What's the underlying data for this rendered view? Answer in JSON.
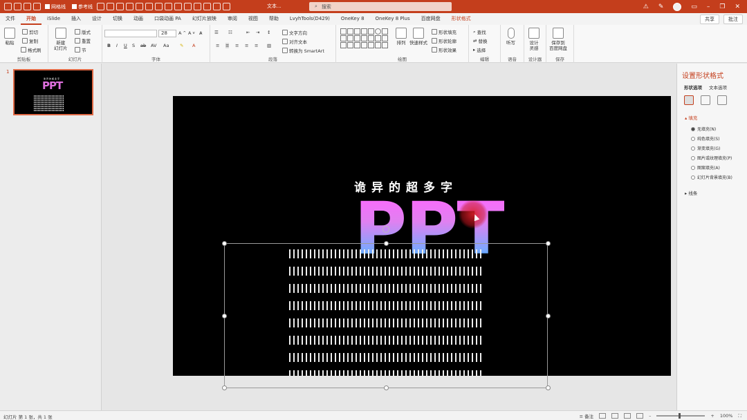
{
  "colors": {
    "accent": "#c43e1c",
    "slide_bg": "#000000",
    "ppt_top": "#ff66ff",
    "ppt_bottom": "#1fa4ff"
  },
  "titlebar": {
    "qat_check1": "网格线",
    "qat_check2": "参考线",
    "doc_title": "文本...",
    "search_placeholder": "搜索",
    "icons": [
      "warning-icon",
      "pen-icon",
      "avatar",
      "ribbon-display-icon",
      "minimize-icon",
      "restore-icon",
      "close-icon"
    ]
  },
  "tabs": [
    {
      "label": "文件"
    },
    {
      "label": "开始"
    },
    {
      "label": "iSlide"
    },
    {
      "label": "插入"
    },
    {
      "label": "设计"
    },
    {
      "label": "切换"
    },
    {
      "label": "动画"
    },
    {
      "label": "口袋动画 PA"
    },
    {
      "label": "幻灯片放映"
    },
    {
      "label": "审阅"
    },
    {
      "label": "视图"
    },
    {
      "label": "帮助"
    },
    {
      "label": "LvyhTools(D429)"
    },
    {
      "label": "OneKey 8"
    },
    {
      "label": "OneKey 8 Plus"
    },
    {
      "label": "百度网盘"
    },
    {
      "label": "形状格式"
    }
  ],
  "tabs_right": {
    "share": "共享",
    "comment": "批注"
  },
  "ribbon": {
    "clipboard": {
      "paste": "粘贴",
      "cut": "剪切",
      "copy": "复制",
      "format_painter": "格式刷",
      "label": "剪贴板"
    },
    "slides": {
      "new_slide": "新建\n幻灯片",
      "layout": "版式",
      "reset": "重置",
      "section": "节",
      "label": "幻灯片"
    },
    "font": {
      "name_value": "",
      "size_value": "28",
      "label": "字体",
      "case": "Aa"
    },
    "paragraph": {
      "text_direction": "文字方向",
      "align_text": "对齐文本",
      "smartart": "转换为 SmartArt",
      "label": "段落"
    },
    "drawing": {
      "arrange": "排列",
      "quick_styles": "快速样式",
      "shape_fill": "形状填充",
      "shape_outline": "形状轮廓",
      "shape_effects": "形状效果",
      "label": "绘图"
    },
    "editing": {
      "find": "查找",
      "replace": "替换",
      "select": "选择",
      "label": "编辑"
    },
    "voice": {
      "dictate": "听写",
      "label": "语音"
    },
    "designer": {
      "ideas": "设计\n灵感",
      "label": "设计器"
    },
    "save": {
      "save_baidu": "保存到\n百度网盘",
      "label": "保存"
    }
  },
  "thumbnails": {
    "slide_number": "1"
  },
  "slide": {
    "title": "诡异的超多字",
    "big_text": "PPT",
    "bar_rows": 8
  },
  "format_pane": {
    "title": "设置形状格式",
    "tab_shape": "形状选项",
    "tab_text": "文本选项",
    "fill_section": "填充",
    "fill_options": [
      "无填充(N)",
      "纯色填充(S)",
      "渐变填充(G)",
      "图片或纹理填充(P)",
      "图案填充(A)",
      "幻灯片背景填充(B)"
    ],
    "selected_fill": 0,
    "line_section": "线条"
  },
  "statusbar": {
    "slide_info": "幻灯片 第 1 张，共 1 张",
    "notes": "备注",
    "zoom": "100%"
  }
}
